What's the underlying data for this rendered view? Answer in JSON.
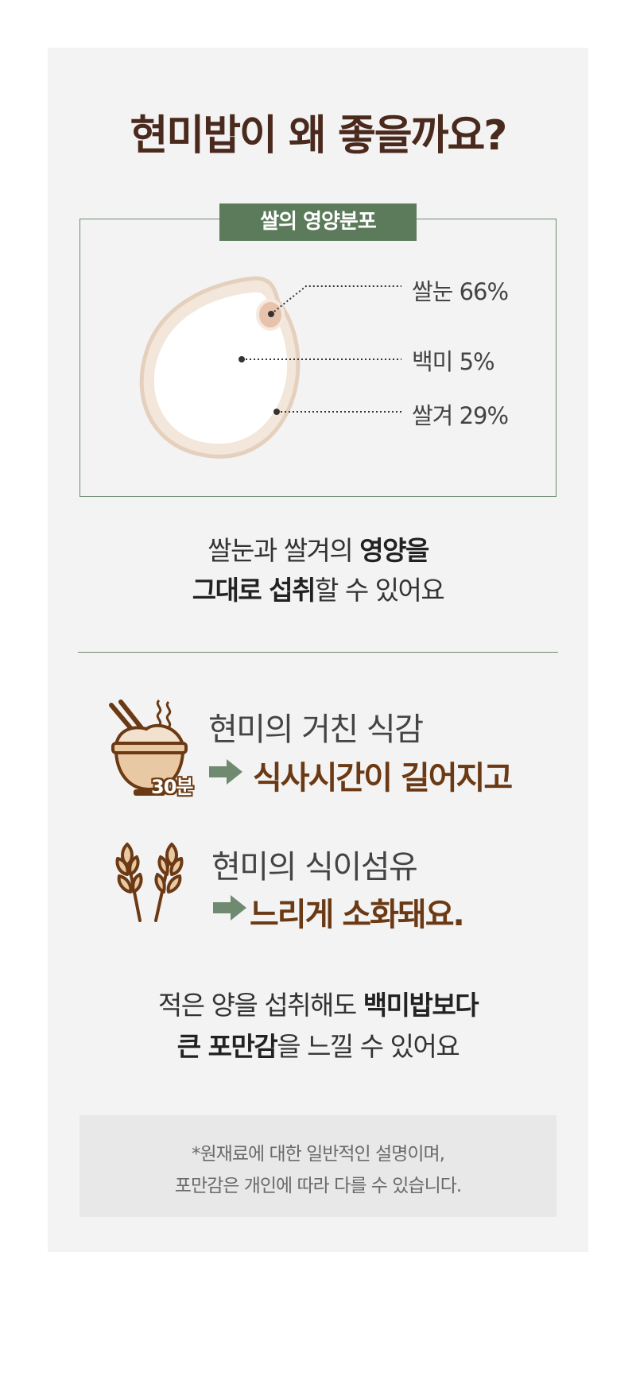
{
  "title": "현미밥이 왜 좋을까요?",
  "nutrition": {
    "label": "쌀의 영양분포",
    "parts": [
      {
        "name": "쌀눈",
        "percent": "66%"
      },
      {
        "name": "백미",
        "percent": "5%"
      },
      {
        "name": "쌀겨",
        "percent": "29%"
      }
    ]
  },
  "caption1": {
    "line1_plain": "쌀눈과 쌀겨의 ",
    "line1_bold": "영양을",
    "line2_bold": "그대로 섭취",
    "line2_plain": "할 수 있어요"
  },
  "features": [
    {
      "icon": "rice-bowl-icon",
      "badge": "30분",
      "line1": "현미의 거친 식감",
      "line2": "식사시간이 길어지고"
    },
    {
      "icon": "wheat-icon",
      "line1": "현미의 식이섬유",
      "line2": "느리게 소화돼요."
    }
  ],
  "caption2": {
    "line1_plain": "적은 양을 섭취해도 ",
    "line1_bold": "백미밥보다",
    "line2_bold": "큰 포만감",
    "line2_plain": "을 느낄 수 있어요"
  },
  "note": {
    "line1": "*원재료에 대한 일반적인 설명이며,",
    "line2": "포만감은 개인에 따라 다를 수 있습니다."
  },
  "colors": {
    "title": "#4b2a1e",
    "accent_green": "#5b7b5b",
    "feature_brown": "#6b3a14",
    "panel_bg": "#f3f3f3"
  }
}
